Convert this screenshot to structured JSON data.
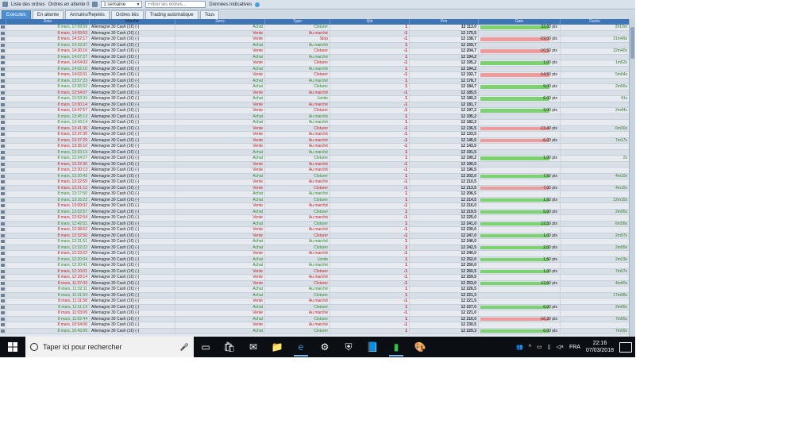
{
  "toolbar": {
    "orders_label": "Liste des ordres",
    "pending_label": "Ordres en attente",
    "pending_count": "0",
    "period_value": "1 semaine",
    "filter_placeholder": "Filtrer les ordres...",
    "indicative_label": "Données indicatives"
  },
  "tabs": [
    "Exécutés",
    "En attente",
    "Annulés/Rejetés",
    "Ordres liés",
    "Trading automatique",
    "Tous"
  ],
  "columns": [
    "Date",
    "Marché",
    "Sens",
    "Type",
    "Qté",
    "Prix",
    "Gain",
    "Durée"
  ],
  "market": "Allemagne 30 Cash (1€) (-)",
  "rows": [
    {
      "date": "8 mars, 17:09:59",
      "sens": "Achat",
      "type": "Cloturer",
      "qty": "1",
      "prix": "12 113,0",
      "gain": "32,60 pts",
      "gain_frac": 0.85,
      "sign": "pos",
      "dur": "2h10m"
    },
    {
      "date": "8 mars, 14:59:53",
      "sens": "Vente",
      "type": "Au marché",
      "qty": "-1",
      "prix": "12 175,5",
      "gain": "",
      "gain_frac": 0,
      "sign": "",
      "dur": ""
    },
    {
      "date": "8 mars, 14:52:17",
      "sens": "Vente",
      "type": "Stop",
      "qty": "-1",
      "prix": "12 138,7",
      "gain": "-19,00 pts",
      "gain_frac": 0.85,
      "sign": "neg",
      "dur": "21m49s"
    },
    {
      "date": "8 mars, 14:33:37",
      "sens": "Achat",
      "type": "Au marché",
      "qty": "1",
      "prix": "12 159,7",
      "gain": "",
      "gain_frac": 0,
      "sign": "",
      "dur": ""
    },
    {
      "date": "8 mars, 14:30:16",
      "sens": "Vente",
      "type": "Cloturer",
      "qty": "-1",
      "prix": "12 204,7",
      "gain": "-10,50 pts",
      "gain_frac": 0.85,
      "sign": "neg",
      "dur": "22m40s"
    },
    {
      "date": "8 mars, 14:07:27",
      "sens": "Achat",
      "type": "Au marché",
      "qty": "1",
      "prix": "12 194,2",
      "gain": "",
      "gain_frac": 0,
      "sign": "",
      "dur": ""
    },
    {
      "date": "8 mars, 14:04:03",
      "sens": "Vente",
      "type": "Cloturer",
      "qty": "-1",
      "prix": "12 195,2",
      "gain": "1,00 pts",
      "gain_frac": 0.85,
      "sign": "pos",
      "dur": "1m52s"
    },
    {
      "date": "8 mars, 14:02:10",
      "sens": "Achat",
      "type": "Au marché",
      "qty": "1",
      "prix": "12 194,2",
      "gain": "",
      "gain_frac": 0,
      "sign": "",
      "dur": ""
    },
    {
      "date": "8 mars, 14:02:01",
      "sens": "Vente",
      "type": "Cloturer",
      "qty": "-1",
      "prix": "12 192,7",
      "gain": "-14,50 pts",
      "gain_frac": 0.85,
      "sign": "neg",
      "dur": "5m04s"
    },
    {
      "date": "8 mars, 13:57:23",
      "sens": "Achat",
      "type": "Au marché",
      "qty": "1",
      "prix": "12 178,7",
      "gain": "",
      "gain_frac": 0,
      "sign": "",
      "dur": ""
    },
    {
      "date": "8 mars, 13:56:52",
      "sens": "Achat",
      "type": "Cloturer",
      "qty": "1",
      "prix": "12 184,7",
      "gain": "9,00 pts",
      "gain_frac": 0.85,
      "sign": "pos",
      "dur": "2m56s"
    },
    {
      "date": "8 mars, 13:54:07",
      "sens": "Vente",
      "type": "Au marché",
      "qty": "-1",
      "prix": "12 185,5",
      "gain": "",
      "gain_frac": 0,
      "sign": "",
      "dur": ""
    },
    {
      "date": "8 mars, 13:53:34",
      "sens": "Achat",
      "type": "Limite",
      "qty": "1",
      "prix": "12 180,2",
      "gain": "6,00 pts",
      "gain_frac": 0.85,
      "sign": "pos",
      "dur": "41s"
    },
    {
      "date": "8 mars, 13:50:14",
      "sens": "Vente",
      "type": "Au marché",
      "qty": "-1",
      "prix": "12 181,7",
      "gain": "",
      "gain_frac": 0,
      "sign": "",
      "dur": ""
    },
    {
      "date": "8 mars, 13:47:57",
      "sens": "Vente",
      "type": "Cloturer",
      "qty": "-1",
      "prix": "12 197,2",
      "gain": "3,00 pts",
      "gain_frac": 0.85,
      "sign": "pos",
      "dur": "2m44s"
    },
    {
      "date": "8 mars, 13:45:13",
      "sens": "Achat",
      "type": "Au marché",
      "qty": "1",
      "prix": "12 195,2",
      "gain": "",
      "gain_frac": 0,
      "sign": "",
      "dur": ""
    },
    {
      "date": "8 mars, 13:43:14",
      "sens": "Achat",
      "type": "Au marché",
      "qty": "1",
      "prix": "12 182,2",
      "gain": "",
      "gain_frac": 0,
      "sign": "",
      "dur": ""
    },
    {
      "date": "8 mars, 13:41:30",
      "sens": "Vente",
      "type": "Cloturer",
      "qty": "-1",
      "prix": "12 136,5",
      "gain": "-13,40 pts",
      "gain_frac": 0.85,
      "sign": "neg",
      "dur": "6m30s"
    },
    {
      "date": "8 mars, 13:37:30",
      "sens": "Vente",
      "type": "Au marché",
      "qty": "-1",
      "prix": "12 133,5",
      "gain": "",
      "gain_frac": 0,
      "sign": "",
      "dur": ""
    },
    {
      "date": "8 mars, 13:37:29",
      "sens": "Vente",
      "type": "Au marché",
      "qty": "-1",
      "prix": "12 145,5",
      "gain": "-6,00 pts",
      "gain_frac": 0.85,
      "sign": "neg",
      "dur": "7m17s"
    },
    {
      "date": "8 mars, 13:35:10",
      "sens": "Vente",
      "type": "Au marché",
      "qty": "-1",
      "prix": "12 143,5",
      "gain": "",
      "gain_frac": 0,
      "sign": "",
      "dur": ""
    },
    {
      "date": "8 mars, 13:33:13",
      "sens": "Achat",
      "type": "Au marché",
      "qty": "1",
      "prix": "12 191,5",
      "gain": "",
      "gain_frac": 0,
      "sign": "",
      "dur": ""
    },
    {
      "date": "8 mars, 13:24:27",
      "sens": "Achat",
      "type": "Cloturer",
      "qty": "1",
      "prix": "12 190,2",
      "gain": "1,00 pts",
      "gain_frac": 0.85,
      "sign": "pos",
      "dur": "2s"
    },
    {
      "date": "8 mars, 13:22:30",
      "sens": "Vente",
      "type": "Au marché",
      "qty": "-1",
      "prix": "12 190,5",
      "gain": "",
      "gain_frac": 0,
      "sign": "",
      "dur": ""
    },
    {
      "date": "8 mars, 13:20:13",
      "sens": "Vente",
      "type": "Au marché",
      "qty": "-1",
      "prix": "12 196,5",
      "gain": "",
      "gain_frac": 0,
      "sign": "",
      "dur": ""
    },
    {
      "date": "8 mars, 13:20:43",
      "sens": "Achat",
      "type": "Cloturer",
      "qty": "1",
      "prix": "12 202,0",
      "gain": "7,50 pts",
      "gain_frac": 0.85,
      "sign": "pos",
      "dur": "4m10s"
    },
    {
      "date": "8 mars, 13:22:55",
      "sens": "Vente",
      "type": "Au marché",
      "qty": "-1",
      "prix": "12 210,5",
      "gain": "",
      "gain_frac": 0,
      "sign": "",
      "dur": ""
    },
    {
      "date": "8 mars, 13:21:13",
      "sens": "Vente",
      "type": "Cloturer",
      "qty": "-1",
      "prix": "12 213,5",
      "gain": "-7,00 pts",
      "gain_frac": 0.85,
      "sign": "neg",
      "dur": "4m15s"
    },
    {
      "date": "8 mars, 13:17:50",
      "sens": "Achat",
      "type": "Au marché",
      "qty": "1",
      "prix": "12 206,5",
      "gain": "",
      "gain_frac": 0,
      "sign": "",
      "dur": ""
    },
    {
      "date": "8 mars, 13:16:23",
      "sens": "Achat",
      "type": "Cloturer",
      "qty": "1",
      "prix": "12 214,5",
      "gain": "1,50 pts",
      "gain_frac": 0.85,
      "sign": "pos",
      "dur": "12m15s"
    },
    {
      "date": "8 mars, 13:09:02",
      "sens": "Vente",
      "type": "Au marché",
      "qty": "-1",
      "prix": "12 216,0",
      "gain": "",
      "gain_frac": 0,
      "sign": "",
      "dur": ""
    },
    {
      "date": "8 mars, 13:02:57",
      "sens": "Achat",
      "type": "Cloturer",
      "qty": "1",
      "prix": "12 219,5",
      "gain": "5,00 pts",
      "gain_frac": 0.85,
      "sign": "pos",
      "dur": "2m05s"
    },
    {
      "date": "8 mars, 12:52:54",
      "sens": "Vente",
      "type": "Au marché",
      "qty": "-1",
      "prix": "12 225,0",
      "gain": "",
      "gain_frac": 0,
      "sign": "",
      "dur": ""
    },
    {
      "date": "8 mars, 12:42:51",
      "sens": "Achat",
      "type": "Cloturer",
      "qty": "1",
      "prix": "12 241,0",
      "gain": "12,50 pts",
      "gain_frac": 0.85,
      "sign": "pos",
      "dur": "6m56s"
    },
    {
      "date": "8 mars, 12:38:52",
      "sens": "Vente",
      "type": "Au marché",
      "qty": "-1",
      "prix": "12 230,0",
      "gain": "",
      "gain_frac": 0,
      "sign": "",
      "dur": ""
    },
    {
      "date": "8 mars, 12:32:50",
      "sens": "Vente",
      "type": "Cloturer",
      "qty": "-1",
      "prix": "12 247,0",
      "gain": "1,00 pts",
      "gain_frac": 0.85,
      "sign": "pos",
      "dur": "2m07s"
    },
    {
      "date": "8 mars, 12:31:51",
      "sens": "Achat",
      "type": "Au marché",
      "qty": "1",
      "prix": "12 246,0",
      "gain": "",
      "gain_frac": 0,
      "sign": "",
      "dur": ""
    },
    {
      "date": "8 mars, 12:32:22",
      "sens": "Achat",
      "type": "Cloturer",
      "qty": "1",
      "prix": "12 242,5",
      "gain": "2,00 pts",
      "gain_frac": 0.85,
      "sign": "pos",
      "dur": "2m09s"
    },
    {
      "date": "8 mars, 12:23:22",
      "sens": "Vente",
      "type": "Au marché",
      "qty": "-1",
      "prix": "12 240,0",
      "gain": "",
      "gain_frac": 0,
      "sign": "",
      "dur": ""
    },
    {
      "date": "8 mars, 12:20:04",
      "sens": "Achat",
      "type": "Limite",
      "qty": "1",
      "prix": "12 252,0",
      "gain": "1,50 pts",
      "gain_frac": 0.85,
      "sign": "pos",
      "dur": "2m23s"
    },
    {
      "date": "8 mars, 12:20:41",
      "sens": "Achat",
      "type": "Au marché",
      "qty": "1",
      "prix": "12 250,0",
      "gain": "",
      "gain_frac": 0,
      "sign": "",
      "dur": ""
    },
    {
      "date": "8 mars, 12:10:01",
      "sens": "Vente",
      "type": "Cloturer",
      "qty": "-1",
      "prix": "12 260,5",
      "gain": "1,00 pts",
      "gain_frac": 0.85,
      "sign": "pos",
      "dur": "7m07s"
    },
    {
      "date": "8 mars, 12:18:14",
      "sens": "Vente",
      "type": "Au marché",
      "qty": "-1",
      "prix": "12 259,5",
      "gain": "",
      "gain_frac": 0,
      "sign": "",
      "dur": ""
    },
    {
      "date": "8 mars, 11:37:03",
      "sens": "Vente",
      "type": "Cloturer",
      "qty": "-1",
      "prix": "12 253,0",
      "gain": "12,50 pts",
      "gain_frac": 0.85,
      "sign": "pos",
      "dur": "4m40s"
    },
    {
      "date": "8 mars, 11:32:11",
      "sens": "Achat",
      "type": "Au marché",
      "qty": "1",
      "prix": "12 226,5",
      "gain": "",
      "gain_frac": 0,
      "sign": "",
      "dur": ""
    },
    {
      "date": "8 mars, 11:31:54",
      "sens": "Achat",
      "type": "Cloturer",
      "qty": "1",
      "prix": "12 221,3",
      "gain": "",
      "gain_frac": 0,
      "sign": "",
      "dur": "17m08s"
    },
    {
      "date": "8 mars, 11:11:58",
      "sens": "Vente",
      "type": "Au marché",
      "qty": "-1",
      "prix": "12 221,5",
      "gain": "",
      "gain_frac": 0,
      "sign": "",
      "dur": ""
    },
    {
      "date": "8 mars, 11:11:13",
      "sens": "Achat",
      "type": "Cloturer",
      "qty": "1",
      "prix": "12 227,0",
      "gain": "6,00 pts",
      "gain_frac": 0.85,
      "sign": "pos",
      "dur": "2m06s"
    },
    {
      "date": "8 mars, 11:03:09",
      "sens": "Vente",
      "type": "Au marché",
      "qty": "-1",
      "prix": "12 221,0",
      "gain": "",
      "gain_frac": 0,
      "sign": "",
      "dur": ""
    },
    {
      "date": "8 mars, 11:02:44",
      "sens": "Achat",
      "type": "Cloturer",
      "qty": "1",
      "prix": "12 216,0",
      "gain": "-16,30 pts",
      "gain_frac": 0.85,
      "sign": "neg",
      "dur": "7m55s"
    },
    {
      "date": "8 mars, 10:54:00",
      "sens": "Vente",
      "type": "Au marché",
      "qty": "-1",
      "prix": "12 230,5",
      "gain": "",
      "gain_frac": 0,
      "sign": "",
      "dur": ""
    },
    {
      "date": "8 mars, 10:43:09",
      "sens": "Achat",
      "type": "Cloturer",
      "qty": "1",
      "prix": "12 229,3",
      "gain": "6,00 pts",
      "gain_frac": 0.85,
      "sign": "pos",
      "dur": "7m09s"
    }
  ],
  "taskbar": {
    "search_placeholder": "Taper ici pour rechercher",
    "lang": "FRA",
    "time": "22:16",
    "date": "07/03/2018"
  }
}
